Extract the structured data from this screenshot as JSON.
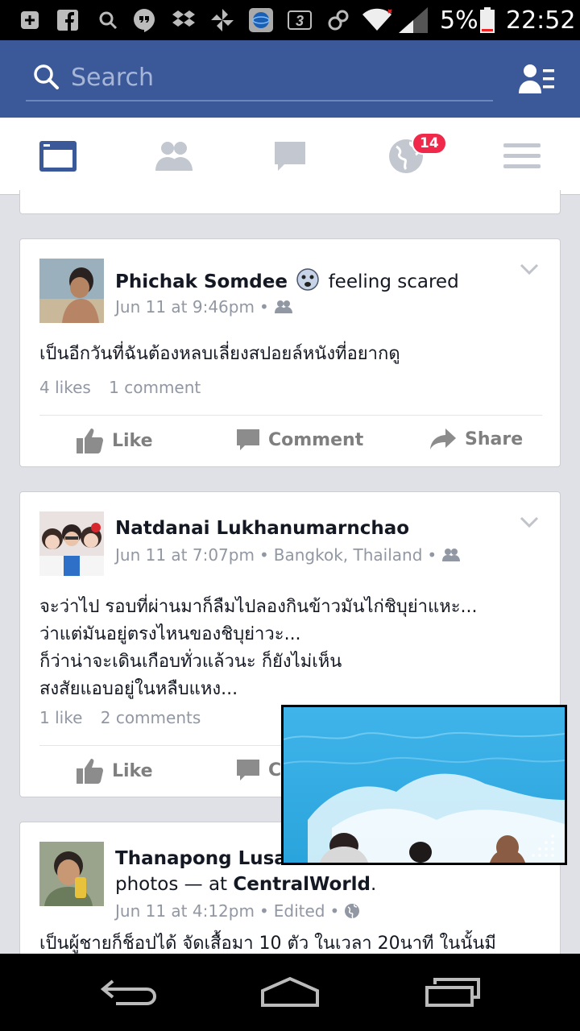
{
  "status_bar": {
    "battery_percent": "5%",
    "time": "22:52",
    "icons": [
      "plus-box-icon",
      "facebook-icon",
      "search-icon",
      "hangouts-icon",
      "dropbox-icon",
      "pinwheel-icon",
      "globe-app-icon",
      "3-icon",
      "link-icon",
      "wifi-icon",
      "signal-icon",
      "battery-icon"
    ]
  },
  "search": {
    "placeholder": "Search"
  },
  "nav": {
    "notifications_count": "14",
    "tabs": [
      "news-feed",
      "friends",
      "messages",
      "notifications",
      "menu"
    ]
  },
  "posts": [
    {
      "author": "Phichak Somdee",
      "feeling": "feeling scared",
      "time": "Jun 11 at 9:46pm",
      "privacy": "friends",
      "text": "เป็นอีกวันที่ฉันต้องหลบเลี่ยงสปอยล์หนังที่อยากดู",
      "likes": "4 likes",
      "comments": "1 comment"
    },
    {
      "author": "Natdanai Lukhanumarnchao",
      "time": "Jun 11 at 7:07pm",
      "location": "Bangkok, Thailand",
      "privacy": "friends",
      "text": "จะว่าไป รอบที่ผ่านมาก็ลืมไปลองกินข้าวมันไก่ชิบุย่าแหะ...\nว่าแต่มันอยู่ตรงไหนของชิบุย่าวะ...\nก็ว่าน่าจะเดินเกือบทั่วแล้วนะ ก็ยังไม่เห็น\nสงสัยแอบอยู่ในหลืบแหง...",
      "likes": "1 like",
      "comments": "2 comments"
    },
    {
      "author": "Thanapong Lusam",
      "line2_prefix": "photos — at ",
      "place": "CentralWorld",
      "line2_suffix": ".",
      "time": "Jun 11 at 4:12pm",
      "edited": "Edited",
      "privacy": "public",
      "text": "เป็นผู้ชายก็ช็อปได้ จัดเสื้อมา 10 ตัว ในเวลา 20นาที ในนั้นมี"
    }
  ],
  "actions": {
    "like": "Like",
    "comment": "Comment",
    "share": "Share",
    "comment_partial": "Co"
  },
  "colors": {
    "brand_blue": "#3b5998",
    "badge_red": "#f0284a",
    "text_dark": "#141823",
    "text_meta": "#9197a3"
  }
}
